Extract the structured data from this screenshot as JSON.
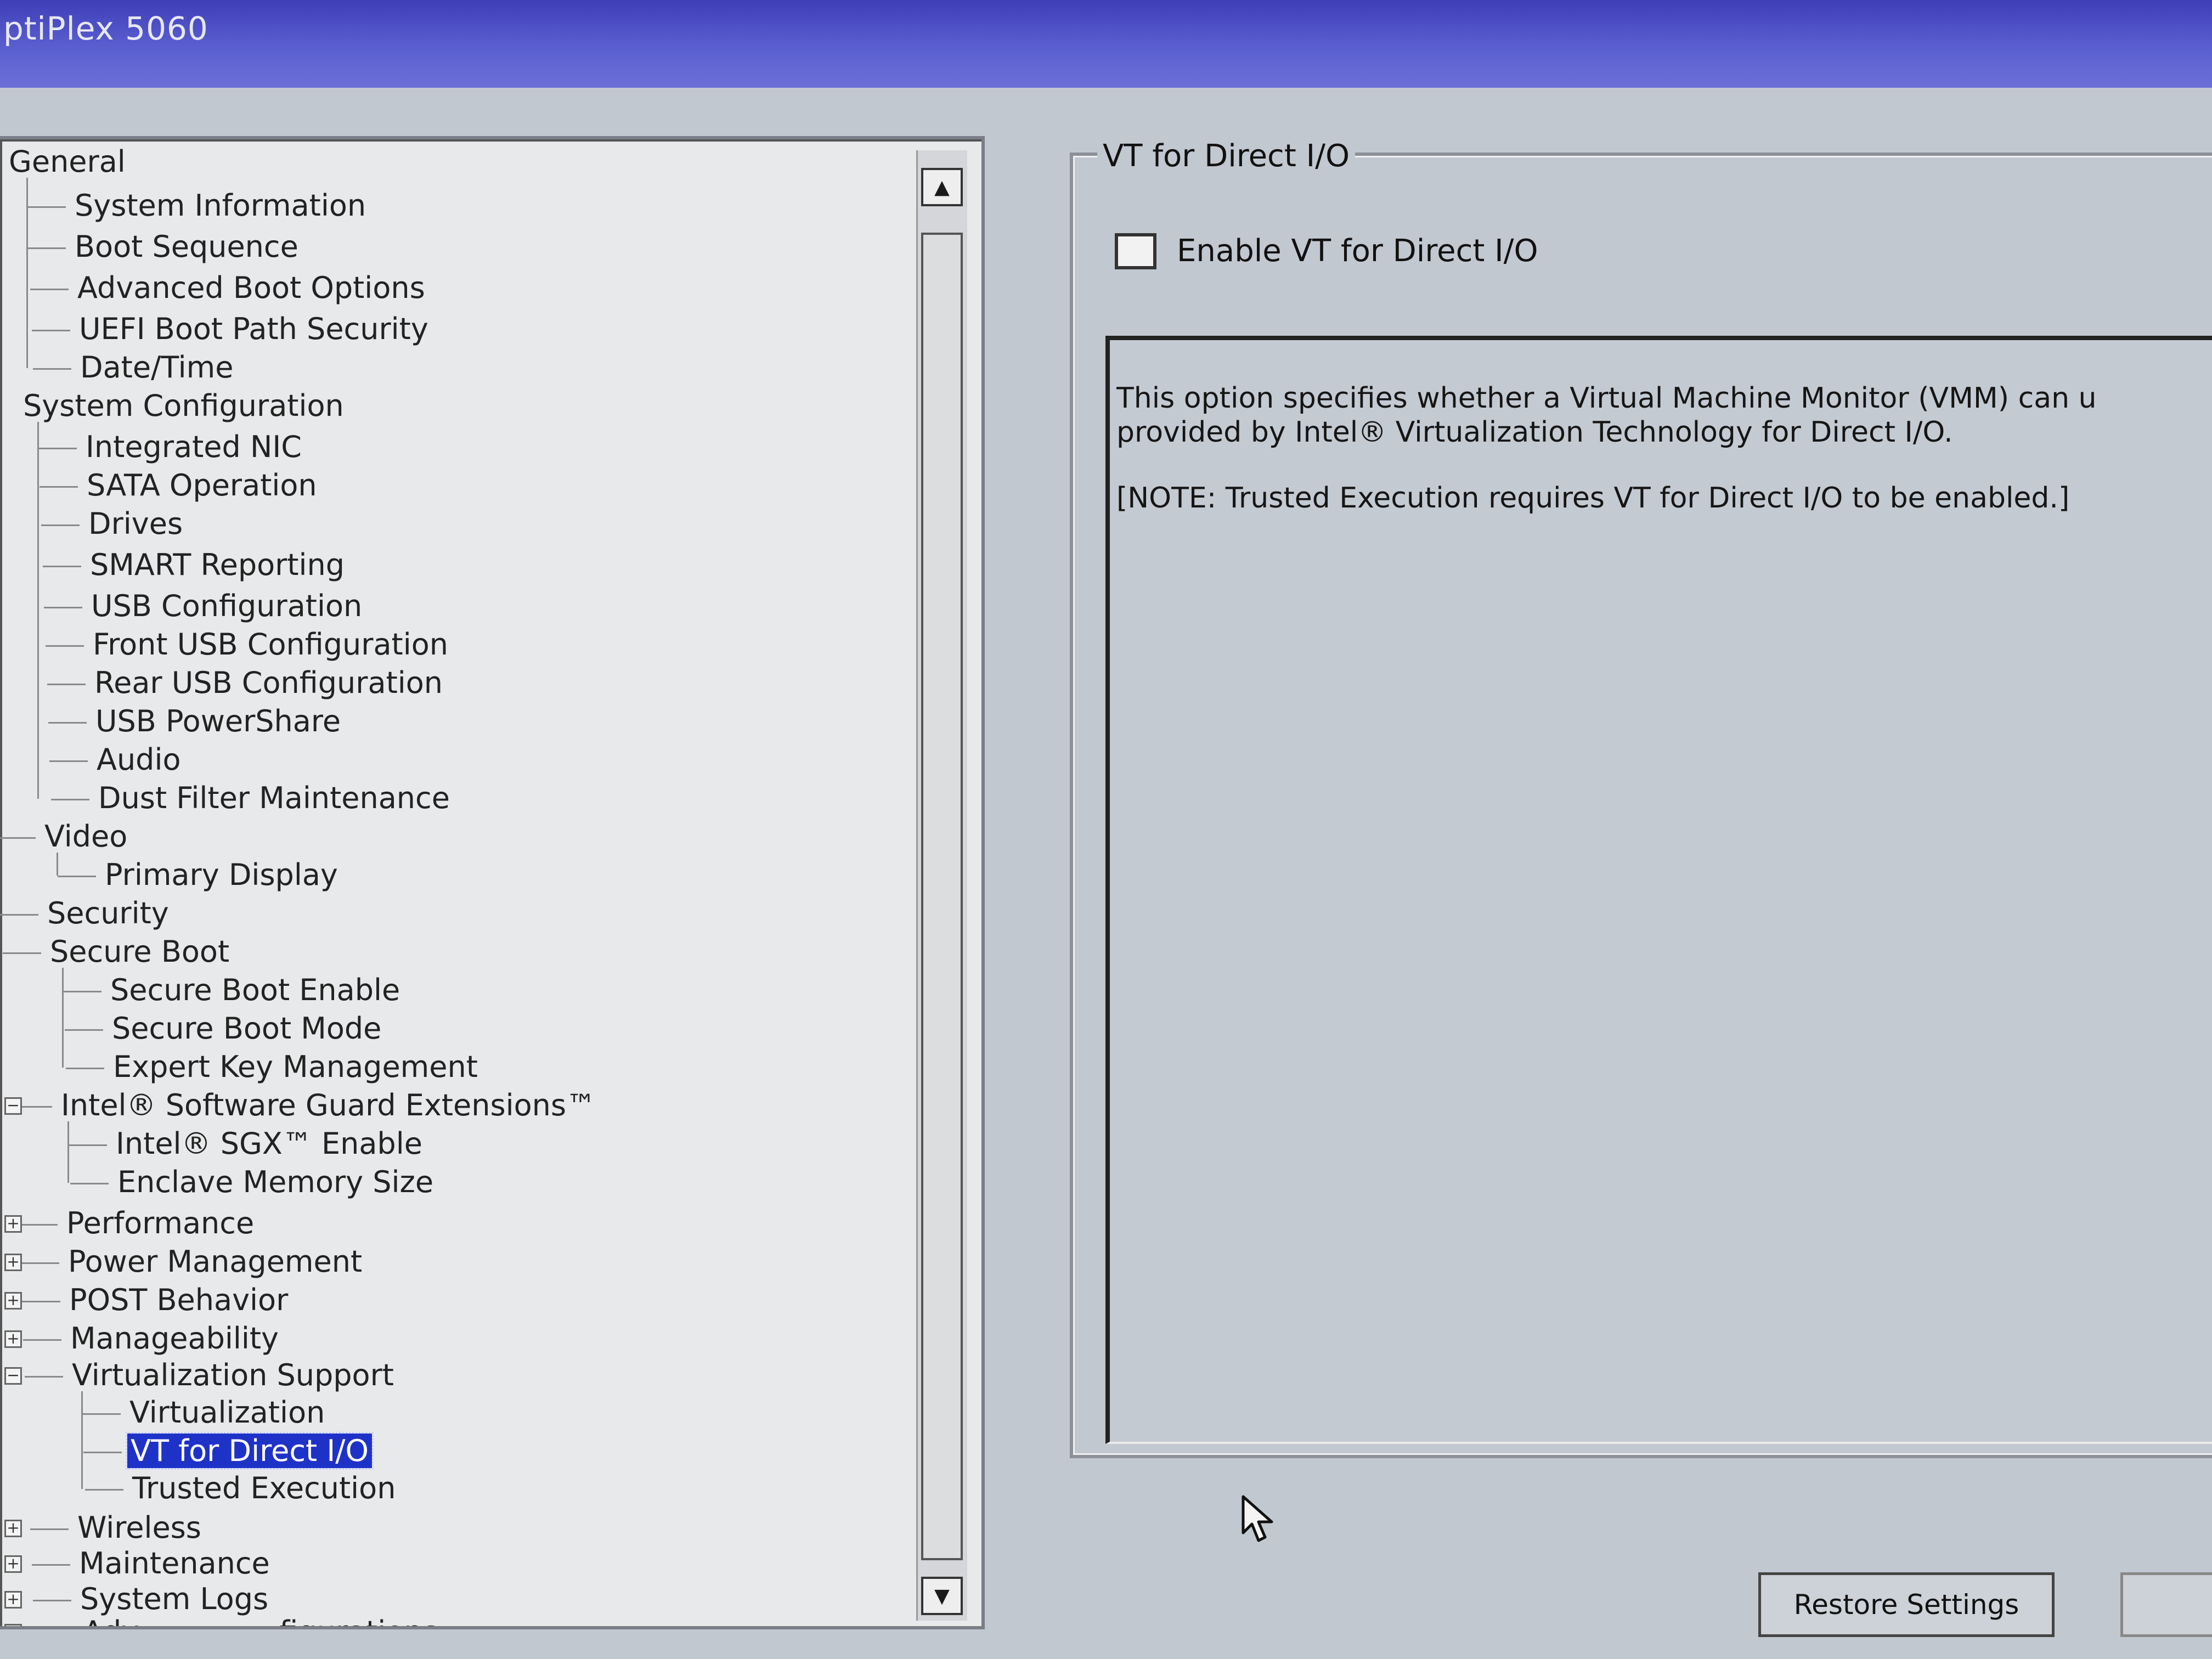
{
  "window": {
    "title": "ptiPlex 5060"
  },
  "tree": {
    "items": [
      {
        "label": "General",
        "expander": ""
      },
      {
        "label": "System Information",
        "expander": ""
      },
      {
        "label": "Boot Sequence",
        "expander": ""
      },
      {
        "label": "Advanced Boot Options",
        "expander": ""
      },
      {
        "label": "UEFI Boot Path Security",
        "expander": ""
      },
      {
        "label": "Date/Time",
        "expander": ""
      },
      {
        "label": "System Configuration",
        "expander": ""
      },
      {
        "label": "Integrated NIC",
        "expander": ""
      },
      {
        "label": "SATA Operation",
        "expander": ""
      },
      {
        "label": "Drives",
        "expander": ""
      },
      {
        "label": "SMART Reporting",
        "expander": ""
      },
      {
        "label": "USB Configuration",
        "expander": ""
      },
      {
        "label": "Front USB Configuration",
        "expander": ""
      },
      {
        "label": "Rear USB Configuration",
        "expander": ""
      },
      {
        "label": "USB PowerShare",
        "expander": ""
      },
      {
        "label": "Audio",
        "expander": ""
      },
      {
        "label": "Dust Filter Maintenance",
        "expander": ""
      },
      {
        "label": "Video",
        "expander": ""
      },
      {
        "label": "Primary Display",
        "expander": ""
      },
      {
        "label": "Security",
        "expander": ""
      },
      {
        "label": "Secure Boot",
        "expander": ""
      },
      {
        "label": "Secure Boot Enable",
        "expander": ""
      },
      {
        "label": "Secure Boot Mode",
        "expander": ""
      },
      {
        "label": "Expert Key Management",
        "expander": ""
      },
      {
        "label": "Intel® Software Guard Extensions™",
        "expander": "−"
      },
      {
        "label": "Intel® SGX™ Enable",
        "expander": ""
      },
      {
        "label": "Enclave Memory Size",
        "expander": ""
      },
      {
        "label": "Performance",
        "expander": "+"
      },
      {
        "label": "Power Management",
        "expander": "+"
      },
      {
        "label": "POST Behavior",
        "expander": "+"
      },
      {
        "label": "Manageability",
        "expander": "+"
      },
      {
        "label": "Virtualization Support",
        "expander": "−"
      },
      {
        "label": "Virtualization",
        "expander": ""
      },
      {
        "label": "VT for Direct I/O",
        "expander": ""
      },
      {
        "label": "Trusted Execution",
        "expander": ""
      },
      {
        "label": "Wireless",
        "expander": "+"
      },
      {
        "label": "Maintenance",
        "expander": "+"
      },
      {
        "label": "System Logs",
        "expander": "+"
      },
      {
        "label": "Adv",
        "expander": "+",
        "trailing": "figurations"
      }
    ],
    "selected_item": "VT for Direct I/O"
  },
  "detail": {
    "group_title": "VT for Direct I/O",
    "checkbox_label": "Enable VT for Direct I/O",
    "checkbox_checked": false,
    "description_line1": "This option specifies whether a Virtual Machine Monitor (VMM) can u",
    "description_line2": "provided by Intel® Virtualization Technology for Direct I/O.",
    "note": "[NOTE: Trusted Execution requires VT for Direct I/O to be enabled.]"
  },
  "buttons": {
    "restore": "Restore Settings"
  }
}
